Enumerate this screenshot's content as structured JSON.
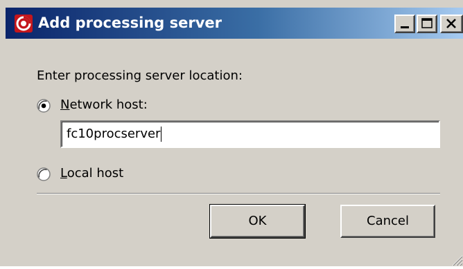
{
  "window": {
    "title": "Add processing server"
  },
  "titlebar": {
    "app_icon": "app-logo-icon",
    "buttons": [
      "minimize-icon",
      "maximize-icon",
      "close-icon"
    ]
  },
  "form": {
    "prompt": "Enter processing server location:",
    "network_host": {
      "label_accel": "N",
      "label_rest": "etwork host:",
      "selected": true
    },
    "host_input": {
      "value": "fc10procserver"
    },
    "local_host": {
      "label_accel": "L",
      "label_rest": "ocal host",
      "selected": false
    }
  },
  "buttons": {
    "ok_label": "OK",
    "cancel_label": "Cancel"
  }
}
